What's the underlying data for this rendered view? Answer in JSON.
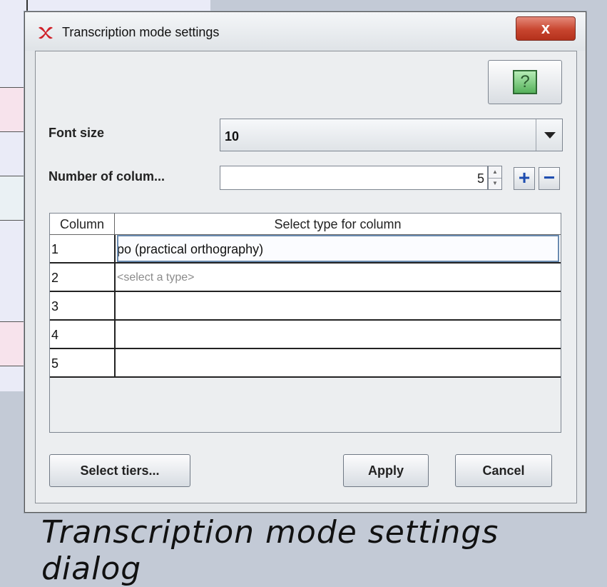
{
  "dialog": {
    "title": "Transcription mode settings",
    "close_label": "x",
    "help_label": "?",
    "font_size_label": "Font size",
    "font_size_value": "10",
    "columns_label": "Number of colum...",
    "columns_value": "5",
    "plus_label": "+",
    "minus_label": "−"
  },
  "table": {
    "headers": [
      "Column",
      "Select type for column"
    ],
    "rows": [
      {
        "num": "1",
        "type": "po (practical orthography)"
      },
      {
        "num": "2",
        "type": "<select a type>"
      },
      {
        "num": "3",
        "type": ""
      },
      {
        "num": "4",
        "type": ""
      },
      {
        "num": "5",
        "type": ""
      }
    ]
  },
  "buttons": {
    "select_tiers": "Select tiers...",
    "apply": "Apply",
    "cancel": "Cancel"
  },
  "caption": "Transcription mode settings dialog",
  "colors": {
    "close_button": "#c8452f",
    "help_icon": "#55b15a",
    "spinner_buttons": "#1e4db0",
    "background_window": "#eaebf7"
  },
  "icons": [
    "app-logo-icon",
    "close-icon",
    "help-icon",
    "dropdown-arrow-icon",
    "spin-up-icon",
    "spin-down-icon",
    "plus-icon",
    "minus-icon"
  ]
}
